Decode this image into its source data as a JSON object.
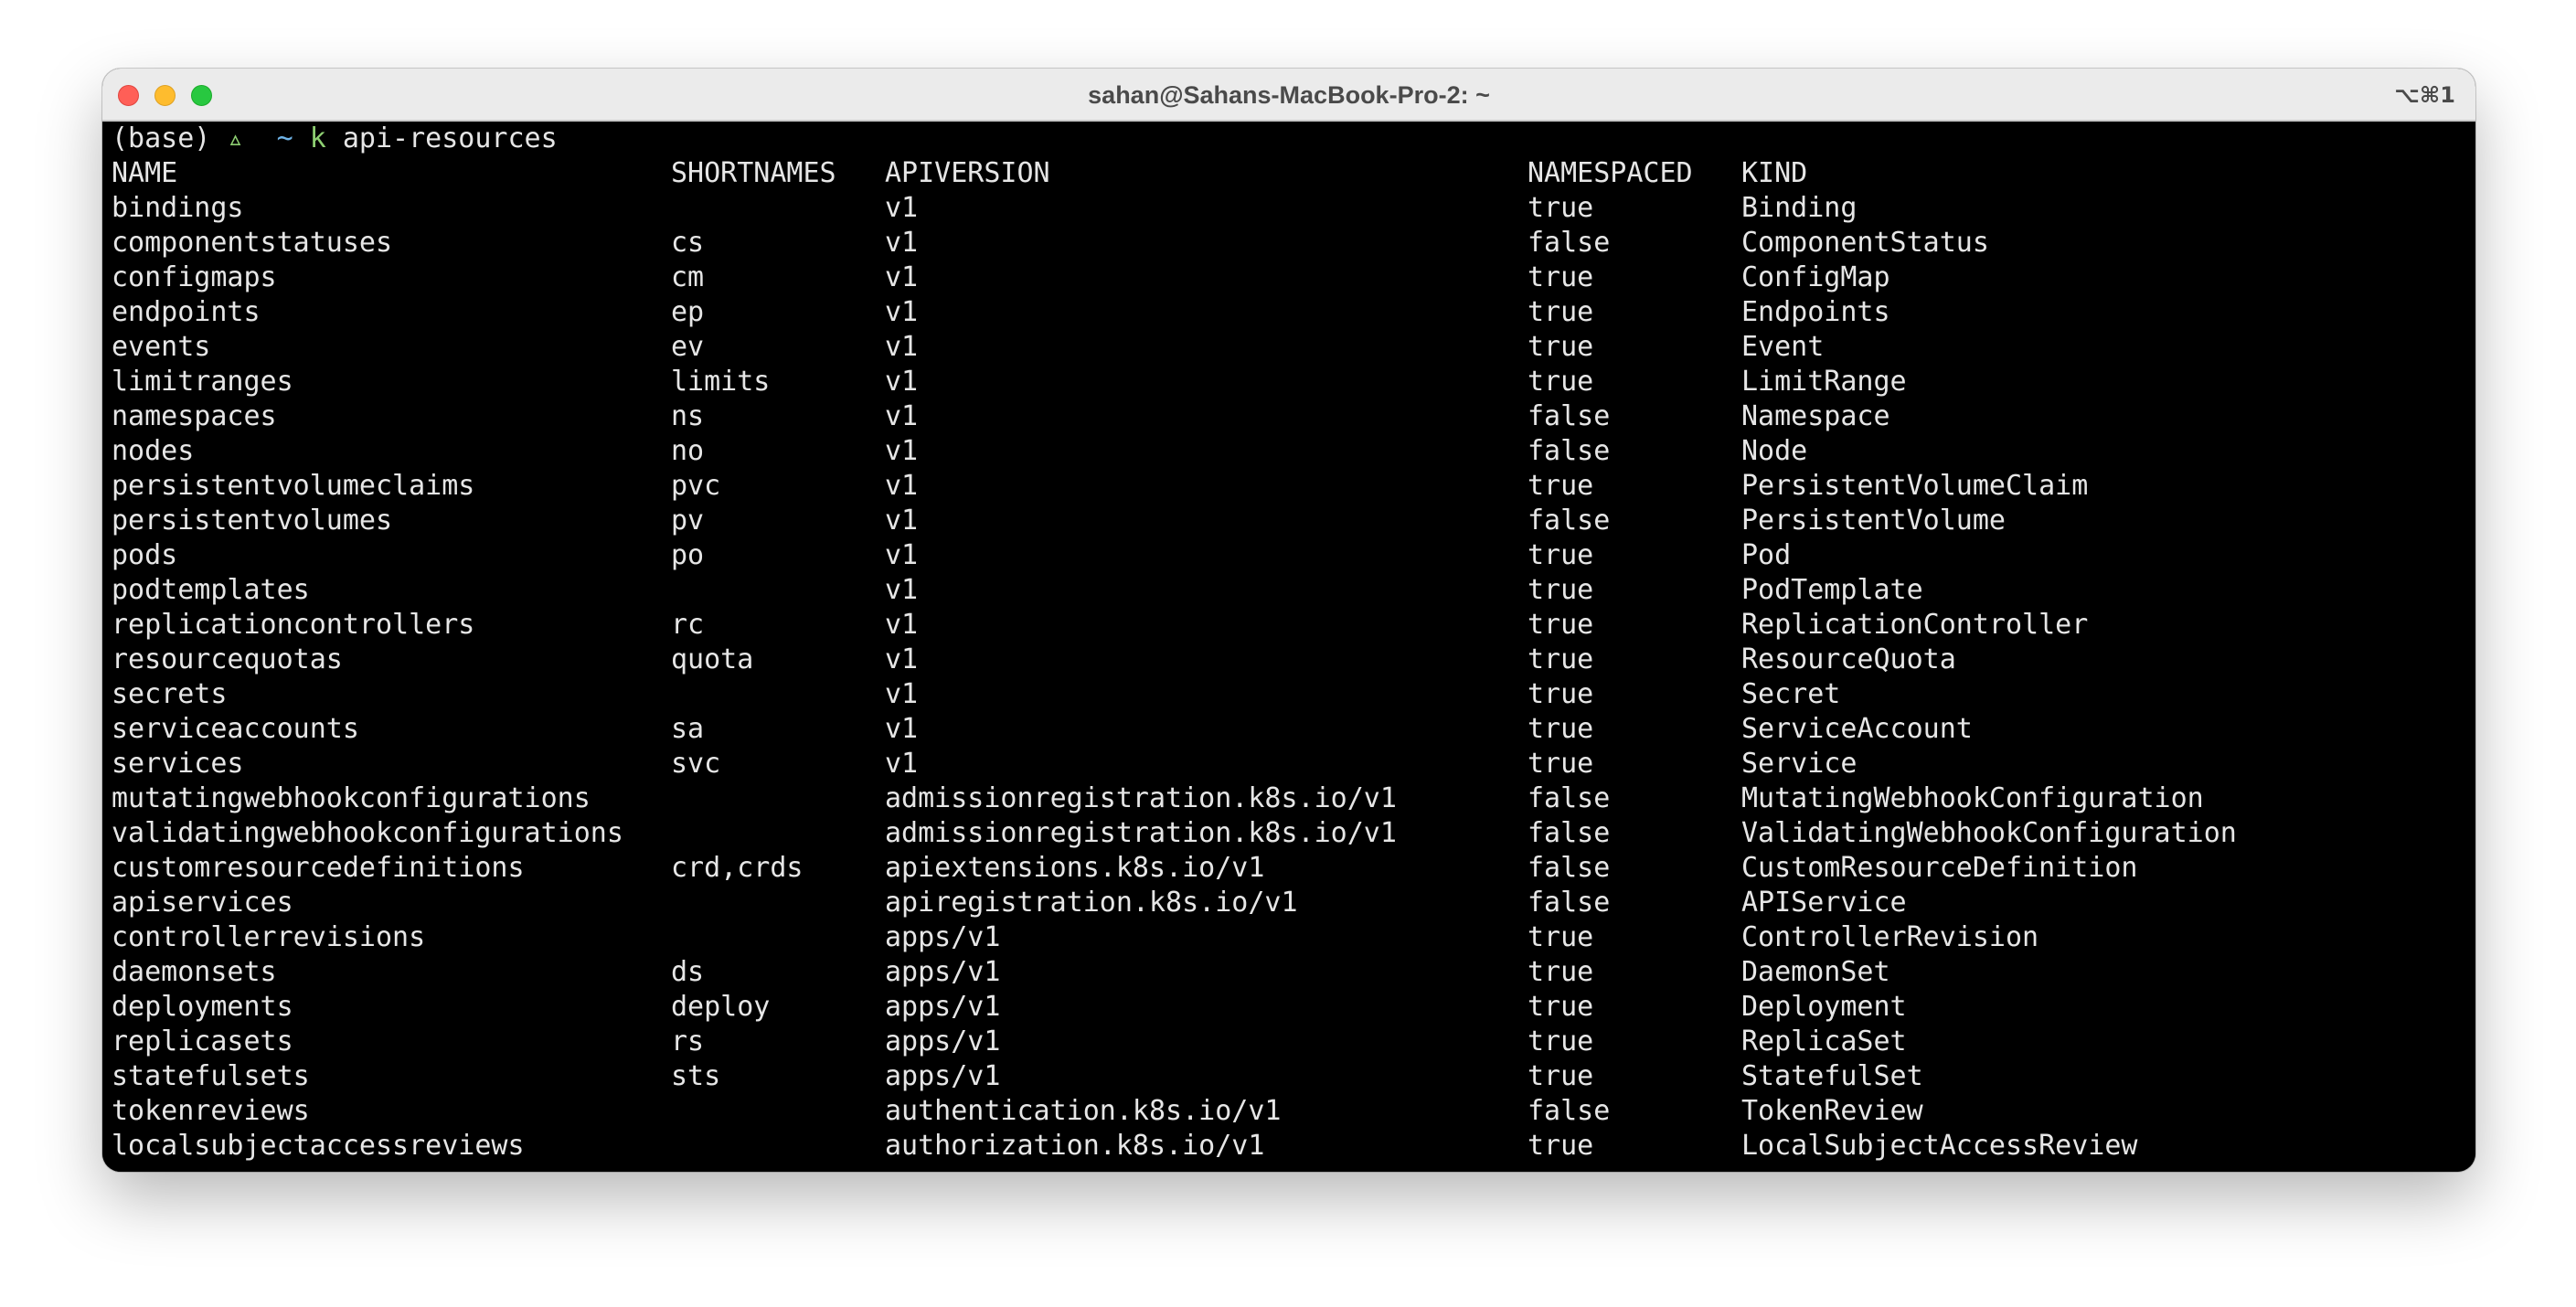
{
  "window": {
    "title": "sahan@Sahans-MacBook-Pro-2: ~",
    "shortcut": "⌥⌘1"
  },
  "prompt": {
    "env": "(base)",
    "arrow": "▵",
    "dir": "~",
    "command": "k",
    "args": "api-resources"
  },
  "table": {
    "headers": {
      "name": "NAME",
      "shortnames": "SHORTNAMES",
      "apiversion": "APIVERSION",
      "namespaced": "NAMESPACED",
      "kind": "KIND"
    },
    "rows": [
      {
        "name": "bindings",
        "shortnames": "",
        "apiversion": "v1",
        "namespaced": "true",
        "kind": "Binding"
      },
      {
        "name": "componentstatuses",
        "shortnames": "cs",
        "apiversion": "v1",
        "namespaced": "false",
        "kind": "ComponentStatus"
      },
      {
        "name": "configmaps",
        "shortnames": "cm",
        "apiversion": "v1",
        "namespaced": "true",
        "kind": "ConfigMap"
      },
      {
        "name": "endpoints",
        "shortnames": "ep",
        "apiversion": "v1",
        "namespaced": "true",
        "kind": "Endpoints"
      },
      {
        "name": "events",
        "shortnames": "ev",
        "apiversion": "v1",
        "namespaced": "true",
        "kind": "Event"
      },
      {
        "name": "limitranges",
        "shortnames": "limits",
        "apiversion": "v1",
        "namespaced": "true",
        "kind": "LimitRange"
      },
      {
        "name": "namespaces",
        "shortnames": "ns",
        "apiversion": "v1",
        "namespaced": "false",
        "kind": "Namespace"
      },
      {
        "name": "nodes",
        "shortnames": "no",
        "apiversion": "v1",
        "namespaced": "false",
        "kind": "Node"
      },
      {
        "name": "persistentvolumeclaims",
        "shortnames": "pvc",
        "apiversion": "v1",
        "namespaced": "true",
        "kind": "PersistentVolumeClaim"
      },
      {
        "name": "persistentvolumes",
        "shortnames": "pv",
        "apiversion": "v1",
        "namespaced": "false",
        "kind": "PersistentVolume"
      },
      {
        "name": "pods",
        "shortnames": "po",
        "apiversion": "v1",
        "namespaced": "true",
        "kind": "Pod"
      },
      {
        "name": "podtemplates",
        "shortnames": "",
        "apiversion": "v1",
        "namespaced": "true",
        "kind": "PodTemplate"
      },
      {
        "name": "replicationcontrollers",
        "shortnames": "rc",
        "apiversion": "v1",
        "namespaced": "true",
        "kind": "ReplicationController"
      },
      {
        "name": "resourcequotas",
        "shortnames": "quota",
        "apiversion": "v1",
        "namespaced": "true",
        "kind": "ResourceQuota"
      },
      {
        "name": "secrets",
        "shortnames": "",
        "apiversion": "v1",
        "namespaced": "true",
        "kind": "Secret"
      },
      {
        "name": "serviceaccounts",
        "shortnames": "sa",
        "apiversion": "v1",
        "namespaced": "true",
        "kind": "ServiceAccount"
      },
      {
        "name": "services",
        "shortnames": "svc",
        "apiversion": "v1",
        "namespaced": "true",
        "kind": "Service"
      },
      {
        "name": "mutatingwebhookconfigurations",
        "shortnames": "",
        "apiversion": "admissionregistration.k8s.io/v1",
        "namespaced": "false",
        "kind": "MutatingWebhookConfiguration"
      },
      {
        "name": "validatingwebhookconfigurations",
        "shortnames": "",
        "apiversion": "admissionregistration.k8s.io/v1",
        "namespaced": "false",
        "kind": "ValidatingWebhookConfiguration"
      },
      {
        "name": "customresourcedefinitions",
        "shortnames": "crd,crds",
        "apiversion": "apiextensions.k8s.io/v1",
        "namespaced": "false",
        "kind": "CustomResourceDefinition"
      },
      {
        "name": "apiservices",
        "shortnames": "",
        "apiversion": "apiregistration.k8s.io/v1",
        "namespaced": "false",
        "kind": "APIService"
      },
      {
        "name": "controllerrevisions",
        "shortnames": "",
        "apiversion": "apps/v1",
        "namespaced": "true",
        "kind": "ControllerRevision"
      },
      {
        "name": "daemonsets",
        "shortnames": "ds",
        "apiversion": "apps/v1",
        "namespaced": "true",
        "kind": "DaemonSet"
      },
      {
        "name": "deployments",
        "shortnames": "deploy",
        "apiversion": "apps/v1",
        "namespaced": "true",
        "kind": "Deployment"
      },
      {
        "name": "replicasets",
        "shortnames": "rs",
        "apiversion": "apps/v1",
        "namespaced": "true",
        "kind": "ReplicaSet"
      },
      {
        "name": "statefulsets",
        "shortnames": "sts",
        "apiversion": "apps/v1",
        "namespaced": "true",
        "kind": "StatefulSet"
      },
      {
        "name": "tokenreviews",
        "shortnames": "",
        "apiversion": "authentication.k8s.io/v1",
        "namespaced": "false",
        "kind": "TokenReview"
      },
      {
        "name": "localsubjectaccessreviews",
        "shortnames": "",
        "apiversion": "authorization.k8s.io/v1",
        "namespaced": "true",
        "kind": "LocalSubjectAccessReview"
      }
    ]
  }
}
